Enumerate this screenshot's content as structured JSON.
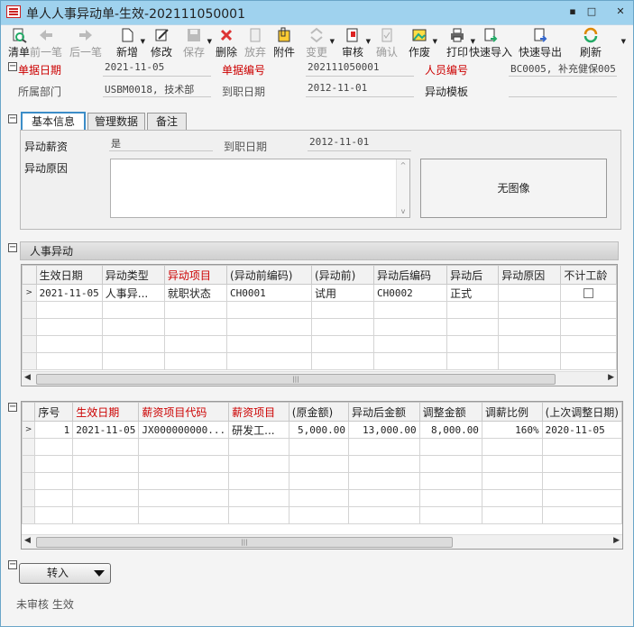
{
  "window": {
    "title": "单人人事异动单-生效-202111050001",
    "minimize": "▪",
    "maximize": "□",
    "close": "✕"
  },
  "toolbar": [
    {
      "key": "clear",
      "label": "清单",
      "icon": "magnifier-doc-icon",
      "disabled": false
    },
    {
      "key": "prev",
      "label": "前一笔",
      "icon": "arrow-left-icon",
      "disabled": true
    },
    {
      "key": "next",
      "label": "后一笔",
      "icon": "arrow-right-icon",
      "disabled": true
    },
    {
      "key": "new",
      "label": "新增",
      "icon": "new-doc-icon",
      "disabled": false,
      "dropdown": true
    },
    {
      "key": "edit",
      "label": "修改",
      "icon": "edit-pencil-icon",
      "disabled": false
    },
    {
      "key": "save",
      "label": "保存",
      "icon": "floppy-disk-icon",
      "disabled": true,
      "dropdown": true
    },
    {
      "key": "delete",
      "label": "删除",
      "icon": "delete-x-icon",
      "disabled": false
    },
    {
      "key": "discard",
      "label": "放弃",
      "icon": "discard-doc-icon",
      "disabled": true
    },
    {
      "key": "attach",
      "label": "附件",
      "icon": "attachment-icon",
      "disabled": false
    },
    {
      "key": "change",
      "label": "变更",
      "icon": "change-arrows-icon",
      "disabled": true,
      "dropdown": true
    },
    {
      "key": "audit",
      "label": "审核",
      "icon": "audit-stamp-icon",
      "disabled": false,
      "dropdown": true
    },
    {
      "key": "confirm",
      "label": "确认",
      "icon": "confirm-doc-icon",
      "disabled": true
    },
    {
      "key": "void",
      "label": "作废",
      "icon": "void-picture-icon",
      "disabled": false,
      "dropdown": true
    },
    {
      "key": "print",
      "label": "打印",
      "icon": "printer-icon",
      "disabled": false,
      "dropdown": true
    },
    {
      "key": "quick_import",
      "label": "快速导入",
      "icon": "quick-import-icon",
      "disabled": false
    },
    {
      "key": "quick_export",
      "label": "快速导出",
      "icon": "quick-export-icon",
      "disabled": false
    },
    {
      "key": "refresh",
      "label": "刷新",
      "icon": "refresh-icon",
      "disabled": false
    }
  ],
  "header": {
    "doc_date_label": "单据日期",
    "doc_date": "2021-11-05",
    "doc_no_label": "单据编号",
    "doc_no": "202111050001",
    "emp_no_label": "人员编号",
    "emp_no": "BC0005, 补充健保005",
    "dept_label": "所属部门",
    "dept": "USBM0018, 技术部",
    "join_date_label": "到职日期",
    "join_date": "2012-11-01",
    "template_label": "异动模板",
    "template": ""
  },
  "tabs": [
    "基本信息",
    "管理数据",
    "备注"
  ],
  "basic": {
    "salary_change_label": "异动薪资",
    "salary_change": "是",
    "join_date_label": "到职日期",
    "join_date": "2012-11-01",
    "reason_label": "异动原因",
    "reason": "",
    "no_image": "无图像"
  },
  "hr_section": {
    "title": "人事异动",
    "columns": [
      {
        "label": "生效日期",
        "required": false
      },
      {
        "label": "异动类型",
        "required": false
      },
      {
        "label": "异动项目",
        "required": true
      },
      {
        "label": "(异动前编码)",
        "required": false
      },
      {
        "label": "(异动前)",
        "required": false
      },
      {
        "label": "异动后编码",
        "required": false
      },
      {
        "label": "异动后",
        "required": false
      },
      {
        "label": "异动原因",
        "required": false
      },
      {
        "label": "不计工龄",
        "required": false
      }
    ],
    "rows": [
      [
        "2021-11-05",
        "人事异...",
        "就职状态",
        "CH0001",
        "试用",
        "CH0002",
        "正式",
        "",
        ""
      ]
    ],
    "row_indicator": ">"
  },
  "salary_section": {
    "columns": [
      {
        "label": "序号",
        "required": false
      },
      {
        "label": "生效日期",
        "required": true
      },
      {
        "label": "薪资项目代码",
        "required": true
      },
      {
        "label": "薪资项目",
        "required": true
      },
      {
        "label": "(原金额)",
        "required": false
      },
      {
        "label": "异动后金额",
        "required": false
      },
      {
        "label": "调整金额",
        "required": false
      },
      {
        "label": "调薪比例",
        "required": false
      },
      {
        "label": "(上次调整日期)",
        "required": false
      }
    ],
    "rows": [
      [
        "1",
        "2021-11-05",
        "JX000000000...",
        "研发工...",
        "5,000.00",
        "13,000.00",
        "8,000.00",
        "160%",
        "2020-11-05"
      ]
    ],
    "row_indicator": ">"
  },
  "into_button": "转入",
  "status": "未审核 生效"
}
